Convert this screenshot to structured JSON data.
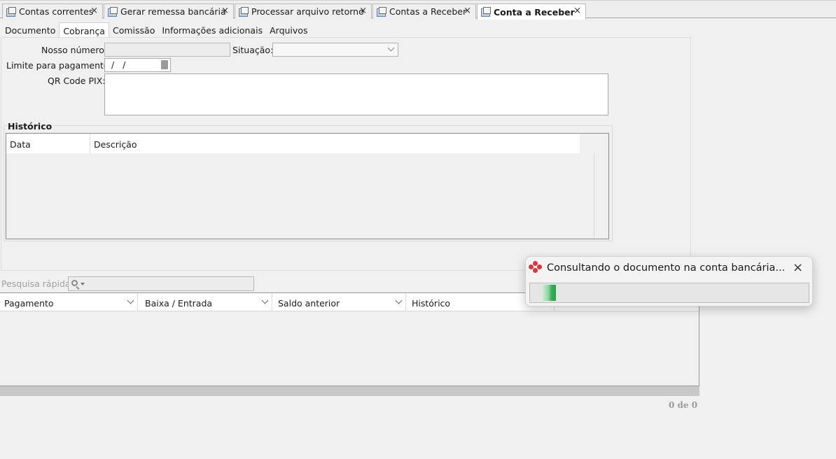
{
  "tabs": [
    {
      "label": "Contas correntes",
      "active": false
    },
    {
      "label": "Gerar remessa bancária",
      "active": false
    },
    {
      "label": "Processar arquivo retorno",
      "active": false
    },
    {
      "label": "Contas a Receber",
      "active": false
    },
    {
      "label": "Conta a Receber",
      "active": true
    }
  ],
  "close_glyph": "×",
  "subtabs": [
    "Documento",
    "Cobrança",
    "Comissão",
    "Informações adicionais",
    "Arquivos"
  ],
  "active_subtab": "Cobrança",
  "form": {
    "nosso_numero_label": "Nosso número:",
    "nosso_numero_value": "",
    "situacao_label": "Situação:",
    "situacao_value": "",
    "limite_label": "Limite para pagamento:",
    "limite_value": "/ /",
    "qrcode_label": "QR Code PIX:",
    "qrcode_value": ""
  },
  "historico": {
    "title": "Histórico",
    "columns": [
      "Data",
      "Descrição"
    ],
    "rows": []
  },
  "quick_search": {
    "label": "Pesquisa rápida:",
    "value": ""
  },
  "grid": {
    "columns": [
      "Pagamento",
      "Baixa / Entrada",
      "Saldo anterior",
      "Histórico"
    ],
    "rows": []
  },
  "record_count": "0 de 0",
  "toast": {
    "message": "Consultando o documento na conta bancária...",
    "progress": 0.05,
    "accent_color": "#21a645"
  }
}
